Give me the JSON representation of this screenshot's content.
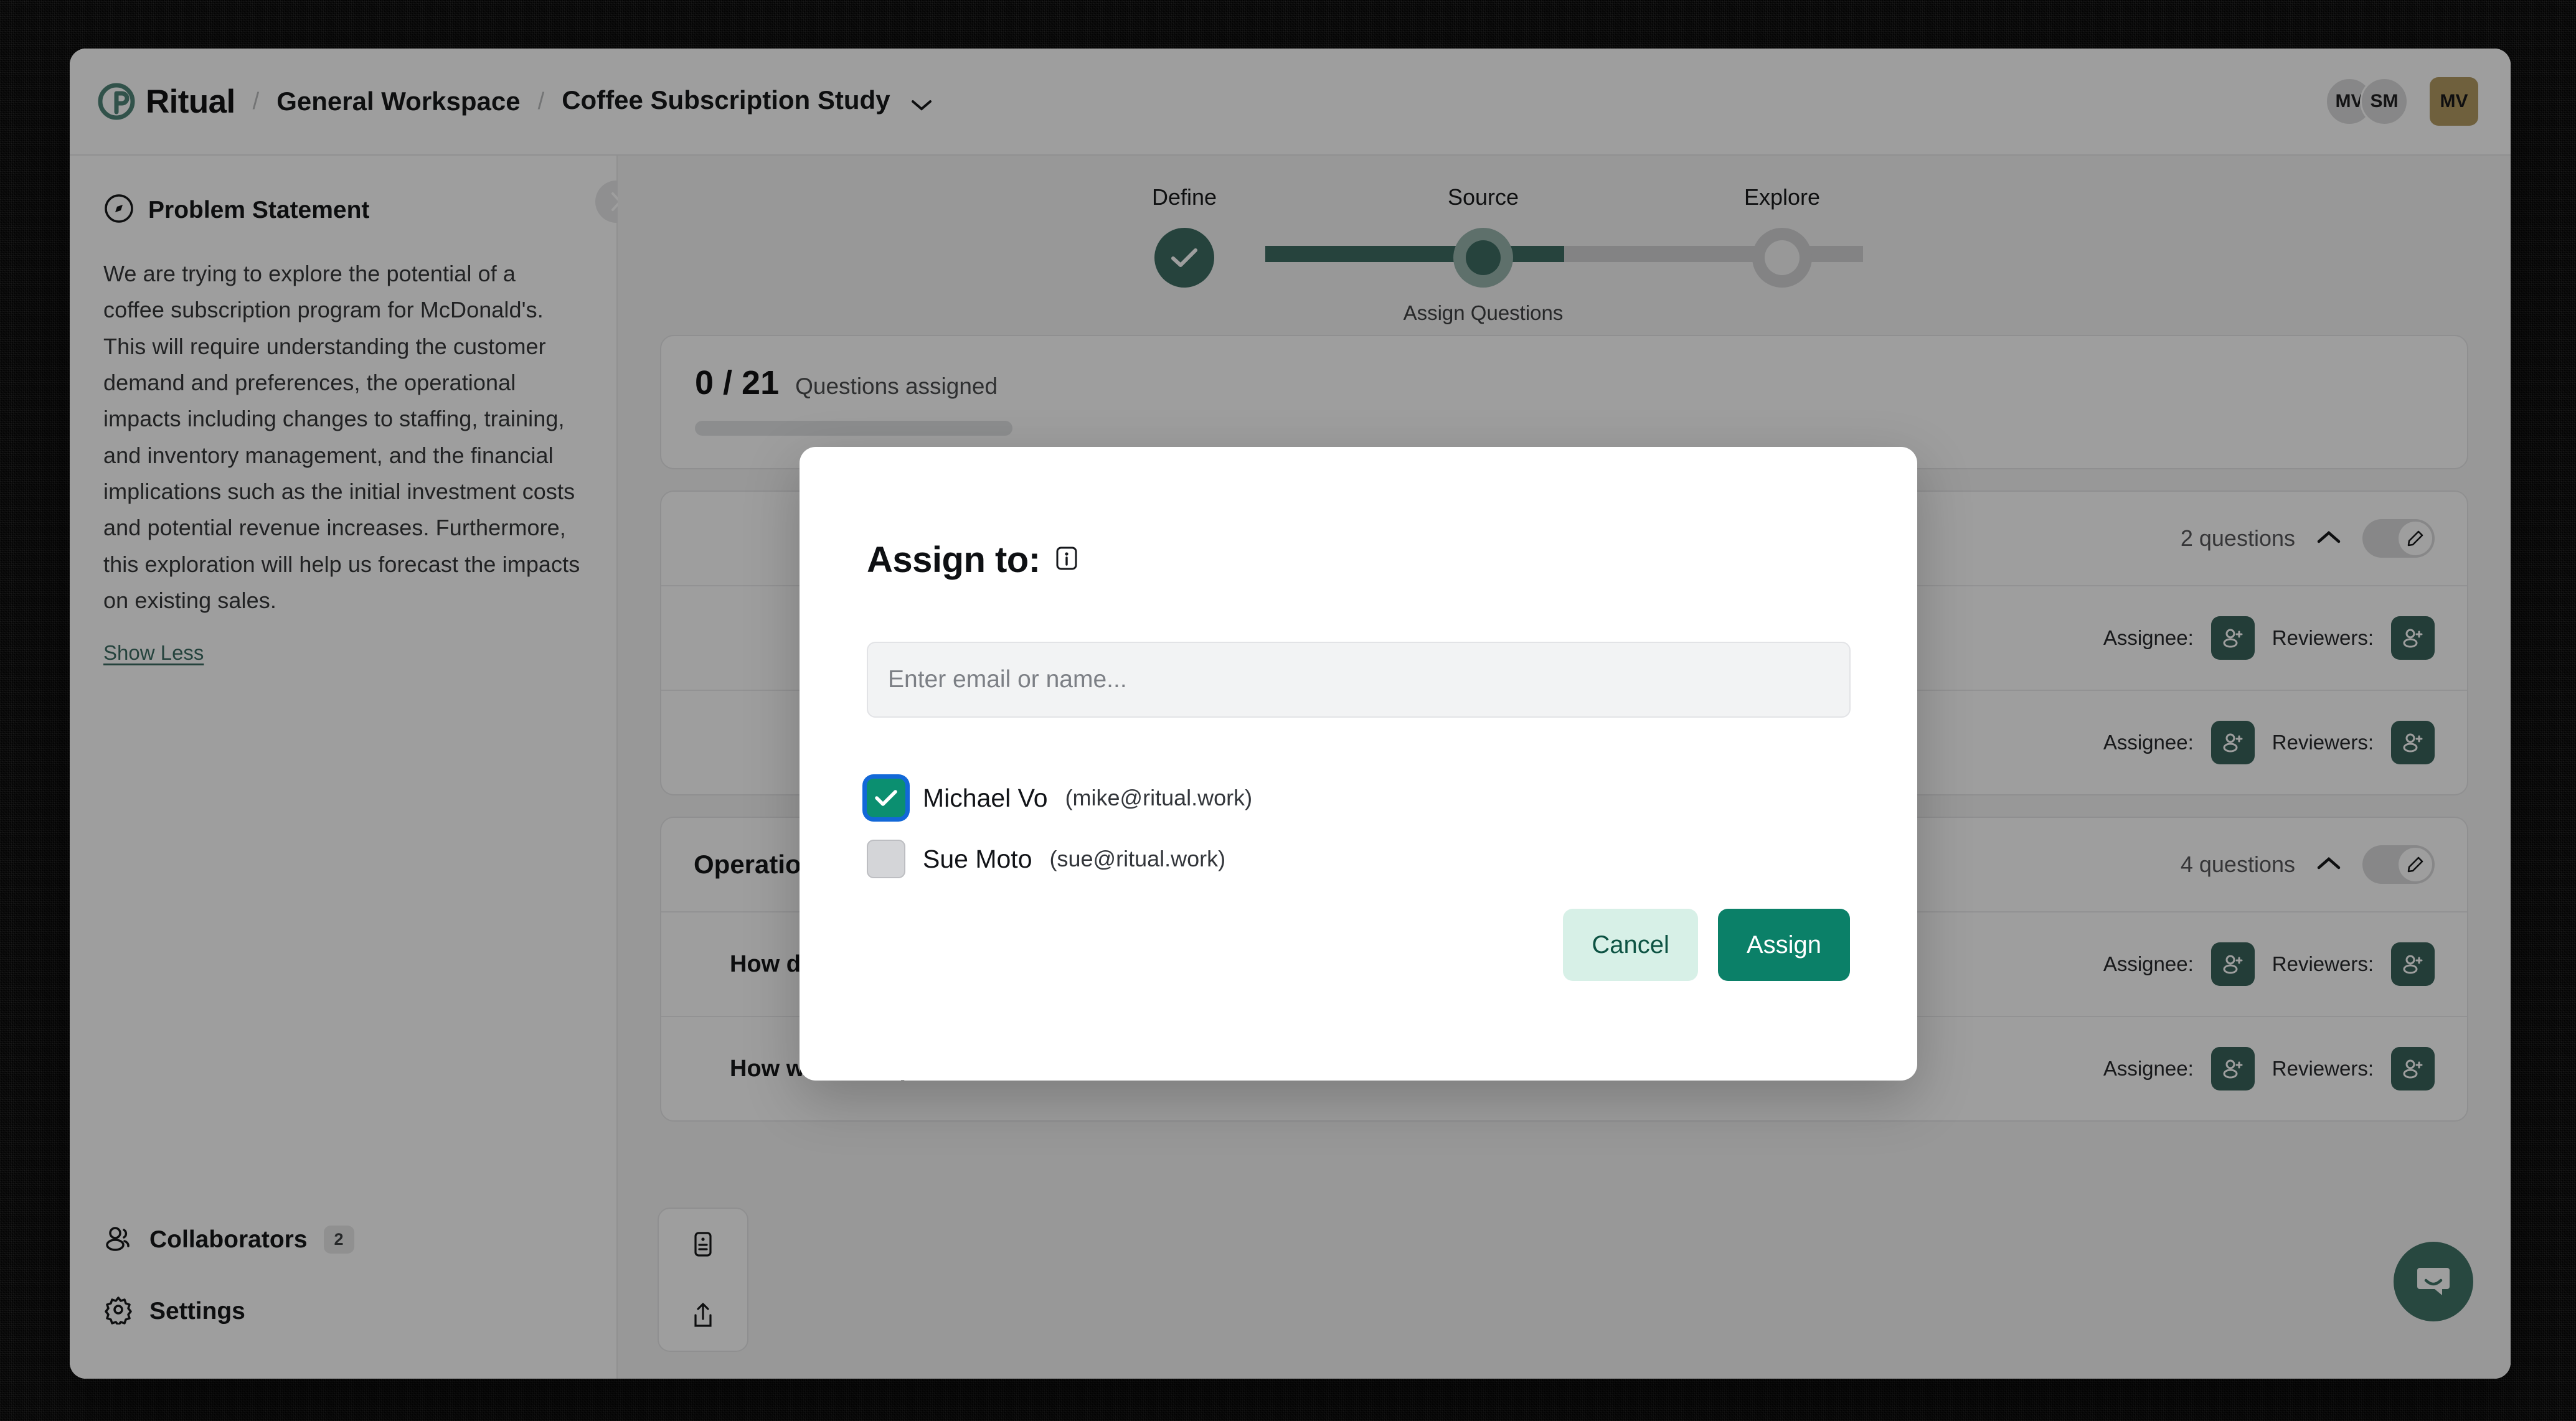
{
  "header": {
    "brand": "Ritual",
    "separator": "/",
    "workspace": "General Workspace",
    "project": "Coffee Subscription Study",
    "avatars": [
      {
        "initials": "MV",
        "kind": "circle"
      },
      {
        "initials": "SM",
        "kind": "circle"
      }
    ],
    "user_avatar": {
      "initials": "MV",
      "color": "#d09a1d"
    }
  },
  "sidebar": {
    "problem_statement": {
      "title": "Problem Statement",
      "body": "We are trying to explore the potential of a coffee subscription program for McDonald's. This will require understanding the customer demand and preferences, the operational impacts including changes to staffing, training, and inventory management, and the financial implications such as the initial investment costs and potential revenue increases. Furthermore, this exploration will help us forecast the impacts on existing sales.",
      "toggle_link": "Show Less"
    },
    "items": [
      {
        "label": "Collaborators",
        "badge": "2",
        "icon": "users-icon"
      },
      {
        "label": "Settings",
        "badge": "",
        "icon": "gear-icon"
      }
    ]
  },
  "stepper": {
    "steps": [
      {
        "label": "Define",
        "state": "done",
        "sublabel": ""
      },
      {
        "label": "Source",
        "state": "current",
        "sublabel": "Assign Questions"
      },
      {
        "label": "Explore",
        "state": "todo",
        "sublabel": ""
      }
    ]
  },
  "progress": {
    "count": "0 / 21",
    "label": "Questions assigned",
    "percent": 0
  },
  "groups": [
    {
      "title": "",
      "count_label": "2 questions",
      "collapse_icon": "chevron-up-icon",
      "edit_icon": "pencil-icon",
      "rows": [
        {
          "text": "",
          "assignee_label": "Assignee:",
          "reviewers_label": "Reviewers:"
        },
        {
          "text": "",
          "assignee_label": "Assignee:",
          "reviewers_label": "Reviewers:"
        }
      ]
    },
    {
      "title": "Operations",
      "count_label": "4 questions",
      "collapse_icon": "chevron-up-icon",
      "edit_icon": "pencil-icon",
      "rows": [
        {
          "text": "How do we quantify a worst case scenario?",
          "assignee_label": "Assignee:",
          "reviewers_label": "Reviewers:"
        },
        {
          "text": "How would we process an order where coffee is one item or several?",
          "assignee_label": "Assignee:",
          "reviewers_label": "Reviewers:"
        }
      ]
    }
  ],
  "modal": {
    "title": "Assign to:",
    "info_icon": "info-icon",
    "input_placeholder": "Enter email or name...",
    "input_value": "",
    "people": [
      {
        "name": "Michael Vo",
        "email": "(mike@ritual.work)",
        "checked": true
      },
      {
        "name": "Sue Moto",
        "email": "(sue@ritual.work)",
        "checked": false
      }
    ],
    "cancel_label": "Cancel",
    "assign_label": "Assign"
  },
  "colors": {
    "brand_teal": "#107a62",
    "accent_gold": "#d09a1d",
    "assign_button": "#0b8068",
    "cancel_button": "#d7f0e7",
    "checkbox_checked": "#0b8f70",
    "focus_ring": "#1268d8"
  },
  "chat": {
    "icon": "chat-bubble-icon"
  },
  "left_rail": [
    {
      "icon": "notes-icon"
    },
    {
      "icon": "share-icon"
    }
  ]
}
